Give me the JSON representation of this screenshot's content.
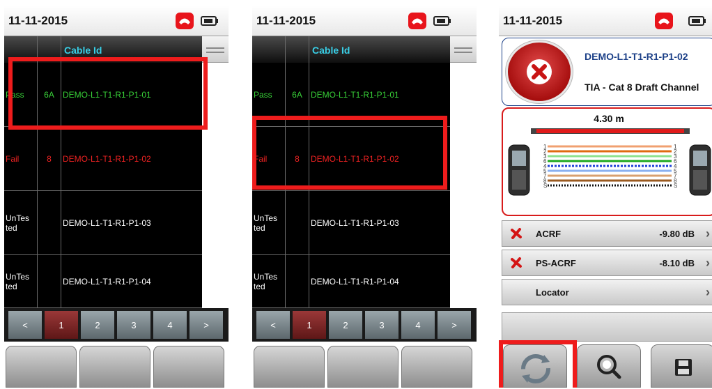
{
  "screens": [
    {
      "date": "11-11-2015",
      "header": {
        "cable_id_label": "Cable Id"
      },
      "rows": [
        {
          "status": "Pass",
          "cat": "6A",
          "cable_id": "DEMO-L1-T1-R1-P1-01"
        },
        {
          "status": "Fail",
          "cat": "8",
          "cable_id": "DEMO-L1-T1-R1-P1-02"
        },
        {
          "status": "UnTes\nted",
          "cat": "",
          "cable_id": "DEMO-L1-T1-R1-P1-03"
        },
        {
          "status": "UnTes\nted",
          "cat": "",
          "cable_id": "DEMO-L1-T1-R1-P1-04"
        }
      ],
      "pager": [
        "<",
        "1",
        "2",
        "3",
        "4",
        ">"
      ],
      "active_page": "1",
      "highlighted_row": "DEMO-L1-T1-R1-P1-01"
    },
    {
      "date": "11-11-2015",
      "header": {
        "cable_id_label": "Cable Id"
      },
      "rows": [
        {
          "status": "Pass",
          "cat": "6A",
          "cable_id": "DEMO-L1-T1-R1-P1-01"
        },
        {
          "status": "Fail",
          "cat": "8",
          "cable_id": "DEMO-L1-T1-R1-P1-02"
        },
        {
          "status": "UnTes\nted",
          "cat": "",
          "cable_id": "DEMO-L1-T1-R1-P1-03"
        },
        {
          "status": "UnTes\nted",
          "cat": "",
          "cable_id": "DEMO-L1-T1-R1-P1-04"
        }
      ],
      "pager": [
        "<",
        "1",
        "2",
        "3",
        "4",
        ">"
      ],
      "active_page": "1",
      "highlighted_row": "DEMO-L1-T1-R1-P1-02"
    }
  ],
  "detail": {
    "date": "11-11-2015",
    "cable_id": "DEMO-L1-T1-R1-P1-02",
    "standard": "TIA - Cat 8 Draft Channel",
    "result": "fail",
    "length": "4.30 m",
    "wire_numbers": [
      "1",
      "2",
      "3",
      "6",
      "4",
      "5",
      "7",
      "8",
      "S"
    ],
    "measurements": [
      {
        "name": "ACRF",
        "value": "-9.80 dB",
        "status": "fail"
      },
      {
        "name": "PS-ACRF",
        "value": "-8.10 dB",
        "status": "fail"
      },
      {
        "name": "Locator",
        "value": "",
        "status": "none"
      }
    ],
    "softkeys": [
      "refresh-icon",
      "search-icon",
      "save-icon"
    ],
    "highlighted_softkey": "refresh-icon"
  },
  "colors": {
    "pass": "#38d138",
    "fail": "#ee2222",
    "cable_id_header": "#39d0e8",
    "active_page": "#7a2222",
    "highlight": "#ee1c1c",
    "title_blue": "#1b3f87"
  }
}
